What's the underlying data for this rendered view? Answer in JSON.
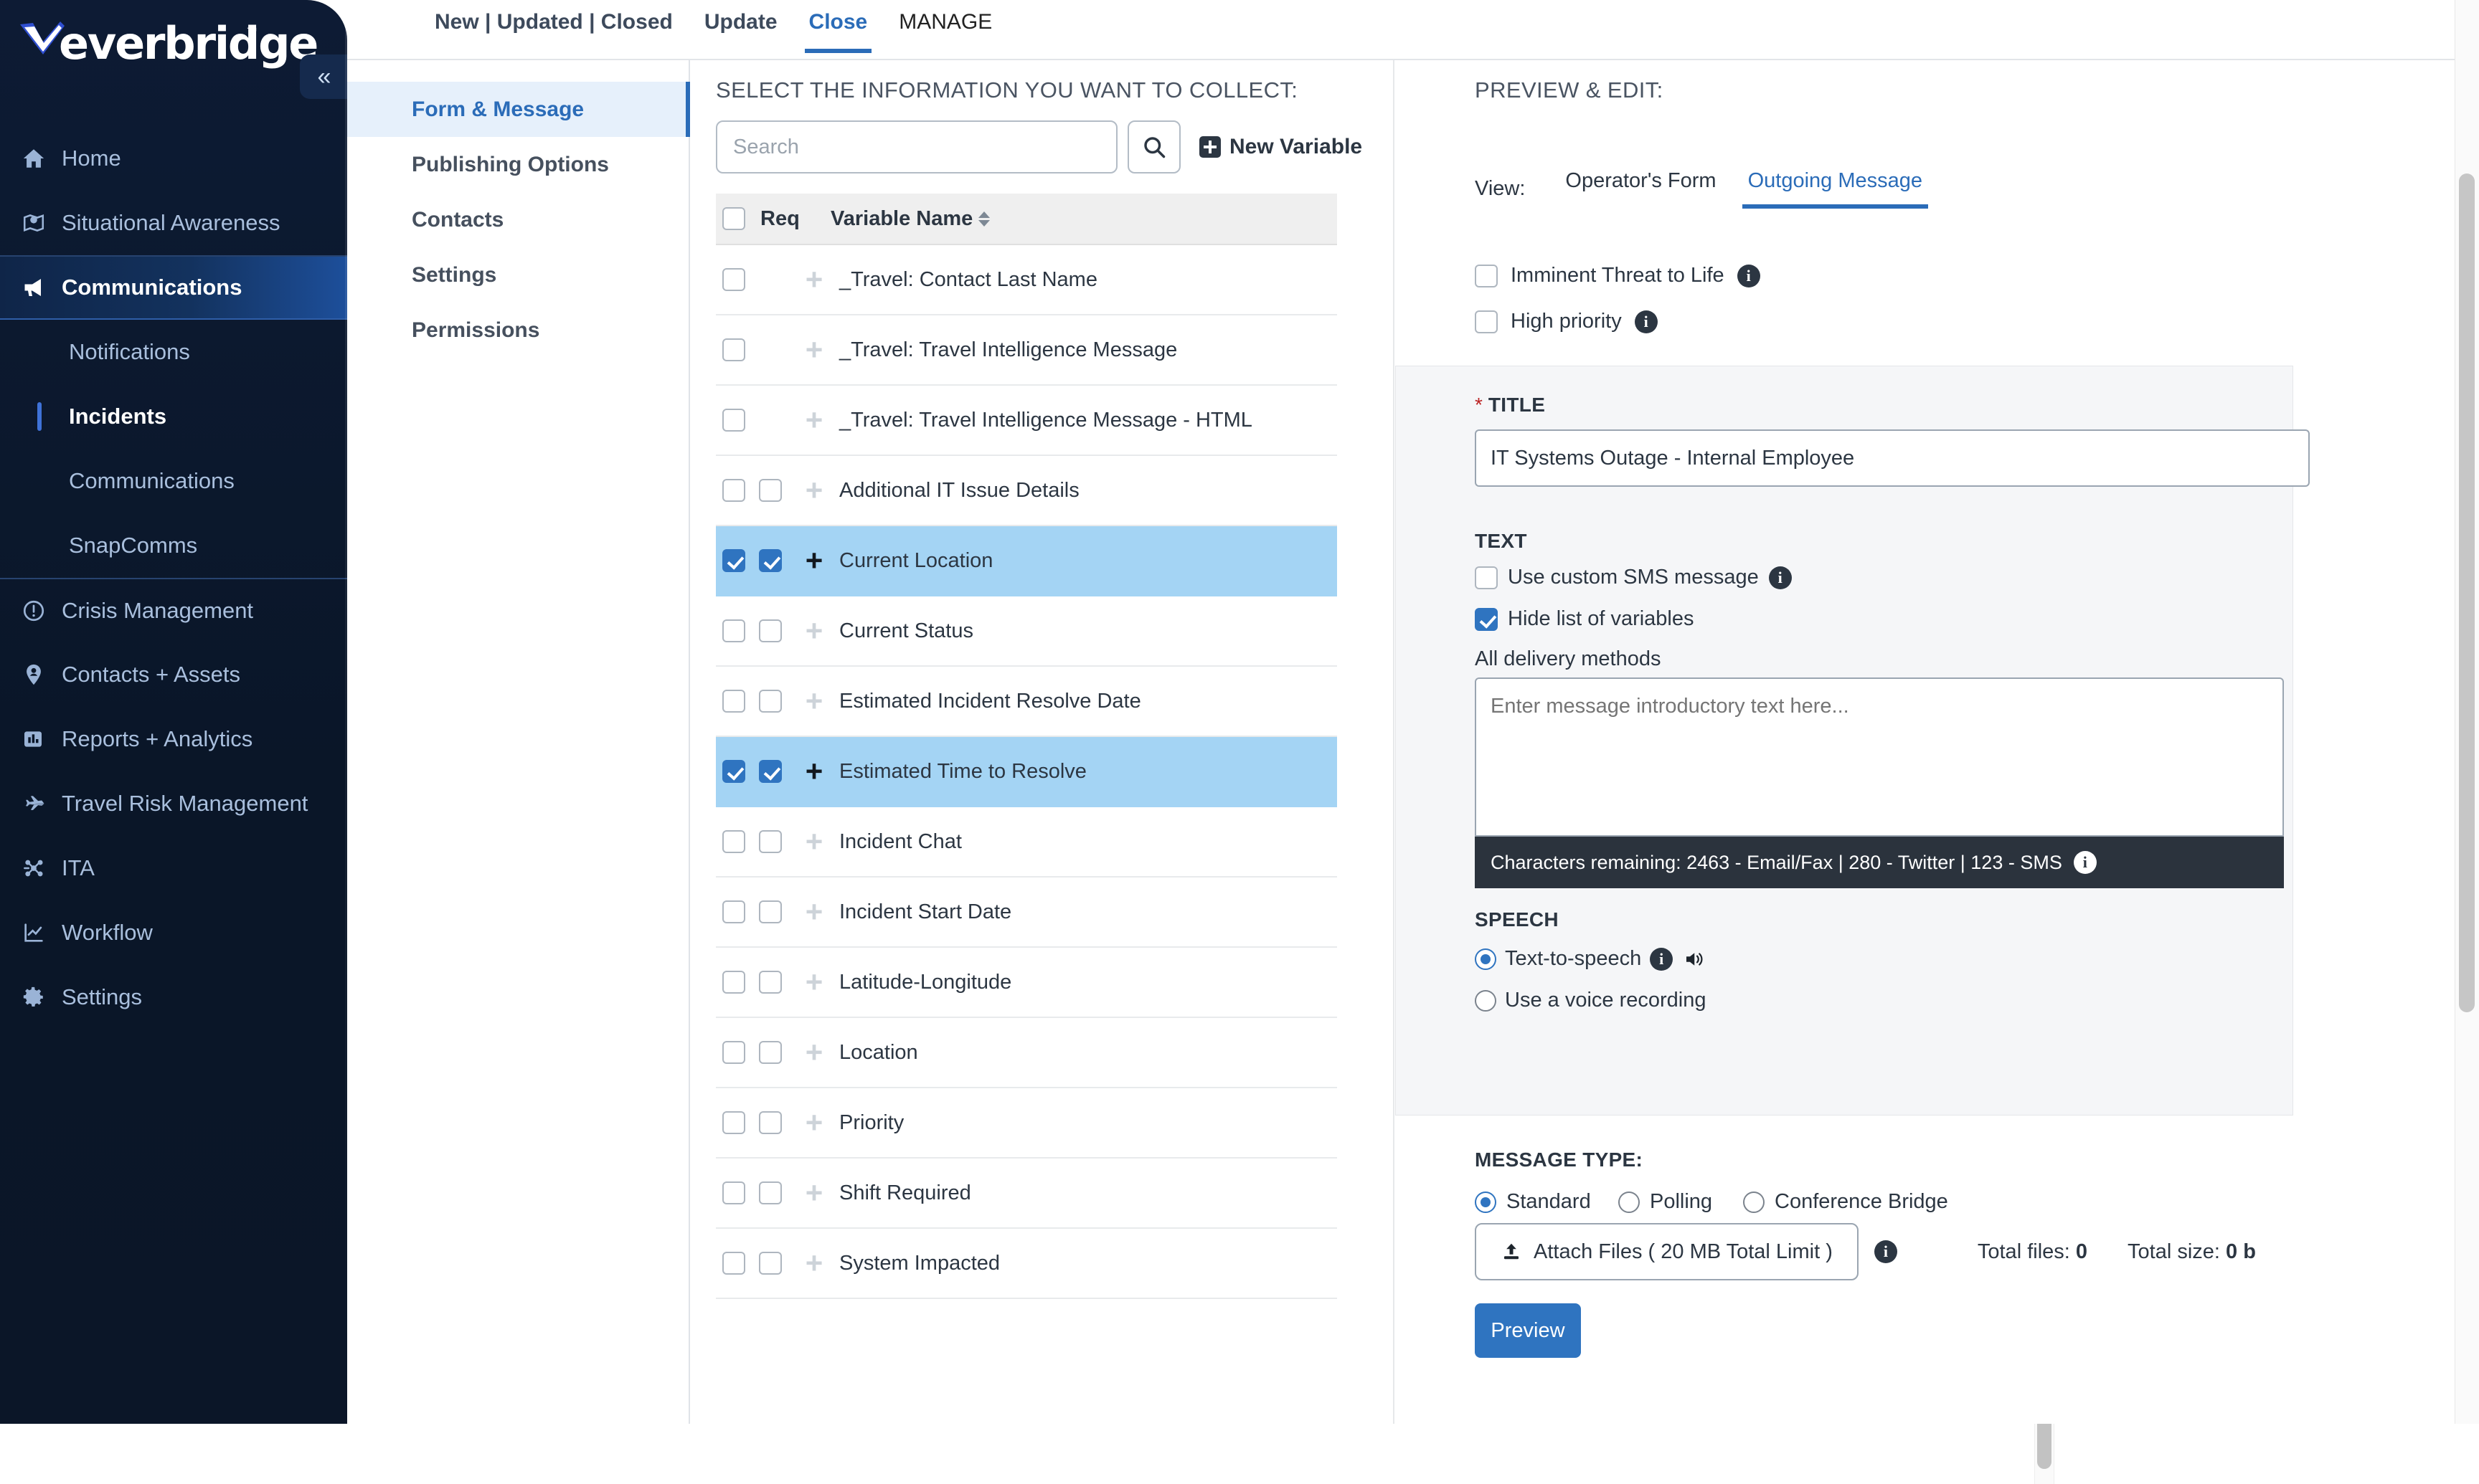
{
  "brand": {
    "name": "everbridge",
    "tm": "™",
    "accent": "#2b6cb8",
    "sidebar_bg": "#0a1628",
    "selected_row": "#a4d4f4"
  },
  "sidebar": {
    "collapse_label": "«",
    "items": [
      {
        "label": "Home",
        "icon": "home-icon",
        "state": "normal"
      },
      {
        "label": "Situational Awareness",
        "icon": "map-pin-icon",
        "state": "normal"
      },
      {
        "label": "Communications",
        "icon": "megaphone-icon",
        "state": "active"
      }
    ],
    "sub_items": [
      {
        "label": "Notifications",
        "state": "normal"
      },
      {
        "label": "Incidents",
        "state": "current"
      },
      {
        "label": "Communications",
        "state": "normal"
      },
      {
        "label": "SnapComms",
        "state": "normal"
      }
    ],
    "items_lower": [
      {
        "label": "Crisis Management",
        "icon": "alert-circle-icon"
      },
      {
        "label": "Contacts + Assets",
        "icon": "contact-pin-icon"
      },
      {
        "label": "Reports + Analytics",
        "icon": "bar-chart-icon"
      },
      {
        "label": "Travel Risk Management",
        "icon": "airplane-icon"
      },
      {
        "label": "ITA",
        "icon": "network-icon"
      },
      {
        "label": "Workflow",
        "icon": "line-chart-icon"
      },
      {
        "label": "Settings",
        "icon": "gear-icon"
      }
    ]
  },
  "topbar": {
    "tabs": [
      {
        "label": "New | Updated | Closed",
        "active": false,
        "style": "bold"
      },
      {
        "label": "Update",
        "active": false,
        "style": "bold"
      },
      {
        "label": "Close",
        "active": true,
        "style": "bold"
      },
      {
        "label": "MANAGE",
        "active": false,
        "style": "plain"
      }
    ]
  },
  "formnav": {
    "items": [
      {
        "label": "Form & Message",
        "active": true
      },
      {
        "label": "Publishing Options",
        "active": false
      },
      {
        "label": "Contacts",
        "active": false
      },
      {
        "label": "Settings",
        "active": false
      },
      {
        "label": "Permissions",
        "active": false
      }
    ]
  },
  "middle": {
    "heading": "SELECT THE INFORMATION YOU WANT TO COLLECT:",
    "search_placeholder": "Search",
    "search_value": "",
    "search_icon": "search-icon",
    "new_variable_label": "New Variable",
    "columns": {
      "select_all": false,
      "req": "Req",
      "variable_name": "Variable Name"
    },
    "rows": [
      {
        "label": "_Travel: Contact Last Name",
        "sel_checked": false,
        "req_checked": false,
        "has_req": false,
        "highlight": false
      },
      {
        "label": "_Travel: Travel Intelligence Message",
        "sel_checked": false,
        "req_checked": false,
        "has_req": false,
        "highlight": false
      },
      {
        "label": "_Travel: Travel Intelligence Message - HTML",
        "sel_checked": false,
        "req_checked": false,
        "has_req": false,
        "highlight": false
      },
      {
        "label": "Additional IT Issue Details",
        "sel_checked": false,
        "req_checked": false,
        "has_req": true,
        "highlight": false
      },
      {
        "label": "Current Location",
        "sel_checked": true,
        "req_checked": true,
        "has_req": true,
        "highlight": true
      },
      {
        "label": "Current Status",
        "sel_checked": false,
        "req_checked": false,
        "has_req": true,
        "highlight": false
      },
      {
        "label": "Estimated Incident Resolve Date",
        "sel_checked": false,
        "req_checked": false,
        "has_req": true,
        "highlight": false
      },
      {
        "label": "Estimated Time to Resolve",
        "sel_checked": true,
        "req_checked": true,
        "has_req": true,
        "highlight": true
      },
      {
        "label": "Incident Chat",
        "sel_checked": false,
        "req_checked": false,
        "has_req": true,
        "highlight": false
      },
      {
        "label": "Incident Start Date",
        "sel_checked": false,
        "req_checked": false,
        "has_req": true,
        "highlight": false
      },
      {
        "label": "Latitude-Longitude",
        "sel_checked": false,
        "req_checked": false,
        "has_req": true,
        "highlight": false
      },
      {
        "label": "Location",
        "sel_checked": false,
        "req_checked": false,
        "has_req": true,
        "highlight": false
      },
      {
        "label": "Priority",
        "sel_checked": false,
        "req_checked": false,
        "has_req": true,
        "highlight": false
      },
      {
        "label": "Shift Required",
        "sel_checked": false,
        "req_checked": false,
        "has_req": true,
        "highlight": false
      },
      {
        "label": "System Impacted",
        "sel_checked": false,
        "req_checked": false,
        "has_req": true,
        "highlight": false
      }
    ]
  },
  "right": {
    "heading": "PREVIEW & EDIT:",
    "view_label": "View:",
    "view_tabs": [
      {
        "label": "Operator's Form",
        "active": false
      },
      {
        "label": "Outgoing Message",
        "active": true
      }
    ],
    "flags": [
      {
        "label": "Imminent Threat to Life",
        "checked": false,
        "info": true
      },
      {
        "label": "High priority",
        "checked": false,
        "info": true
      }
    ],
    "title_section": {
      "required_marker": "*",
      "label": "TITLE",
      "value": "IT Systems Outage - Internal Employee",
      "placeholder": ""
    },
    "text_section": {
      "label": "TEXT",
      "use_custom_sms": {
        "label": "Use custom SMS message",
        "checked": false
      },
      "hide_variables": {
        "label": "Hide list of variables",
        "checked": true
      },
      "delivery_label": "All delivery methods",
      "message_placeholder": "Enter message introductory text here...",
      "message_value": "",
      "char_counter": "Characters remaining:  2463 - Email/Fax  |  280 - Twitter  |  123 - SMS"
    },
    "speech_section": {
      "label": "SPEECH",
      "options": [
        {
          "label": "Text-to-speech",
          "checked": true,
          "info": true,
          "speaker": true
        },
        {
          "label": "Use a voice recording",
          "checked": false,
          "info": false,
          "speaker": false
        }
      ]
    },
    "message_type": {
      "label": "MESSAGE TYPE:",
      "options": [
        {
          "label": "Standard",
          "checked": true
        },
        {
          "label": "Polling",
          "checked": false
        },
        {
          "label": "Conference Bridge",
          "checked": false
        }
      ]
    },
    "attach": {
      "label": "Attach Files ( 20 MB Total Limit )",
      "icon": "upload-icon",
      "info": true,
      "total_files_label": "Total files:",
      "total_files_value": "0",
      "total_size_label": "Total size:",
      "total_size_value": "0 b"
    },
    "preview_button": "Preview"
  }
}
